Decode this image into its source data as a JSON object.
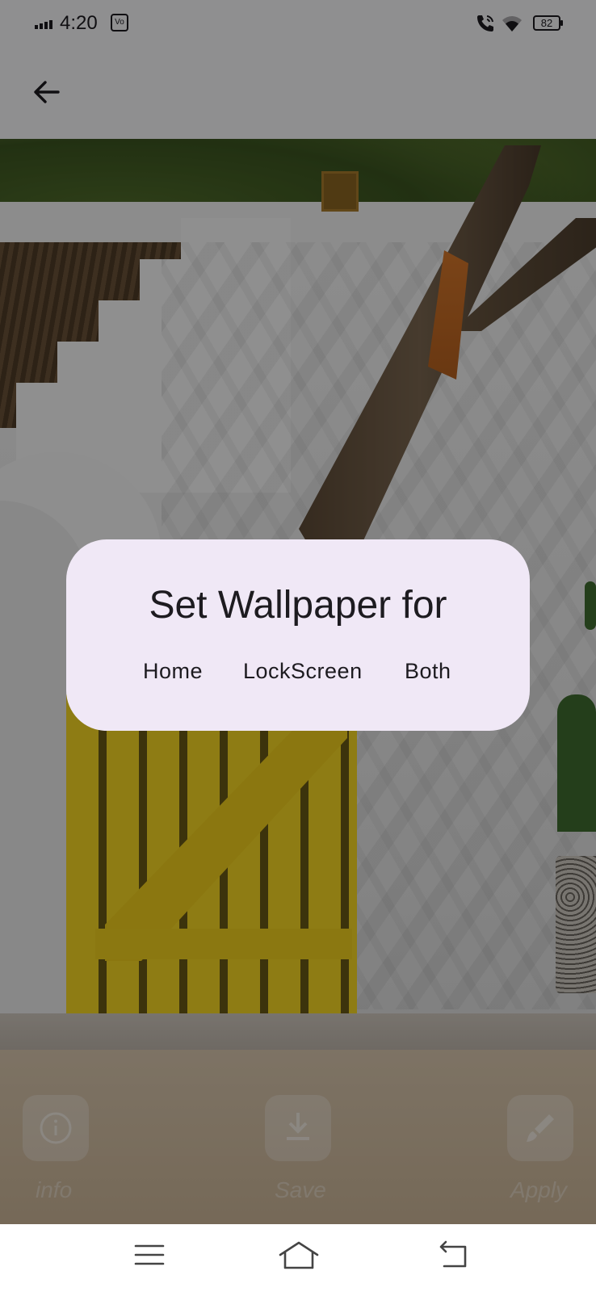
{
  "status_bar": {
    "time": "4:20",
    "sim_glyph": "Vo",
    "battery": "82",
    "icons": [
      "signal-icon",
      "sim-icon",
      "wifi-calling-icon",
      "wifi-icon",
      "battery-icon"
    ]
  },
  "app_bar": {
    "back_icon": "arrow-back-icon"
  },
  "dialog": {
    "title": "Set Wallpaper for",
    "options": [
      {
        "label": "Home"
      },
      {
        "label": "LockScreen"
      },
      {
        "label": "Both"
      }
    ]
  },
  "actions": [
    {
      "label": "info",
      "icon": "info-icon"
    },
    {
      "label": "Save",
      "icon": "download-icon"
    },
    {
      "label": "Apply",
      "icon": "brush-icon"
    }
  ],
  "nav_bar": {
    "icons": [
      "menu-icon",
      "home-icon",
      "back-icon"
    ]
  },
  "colors": {
    "dialog_bg": "#f0e8f6",
    "text": "#1d1b20",
    "topbar_bg": "#f7f6f8",
    "scrim": "rgba(0,0,0,0.42)"
  }
}
